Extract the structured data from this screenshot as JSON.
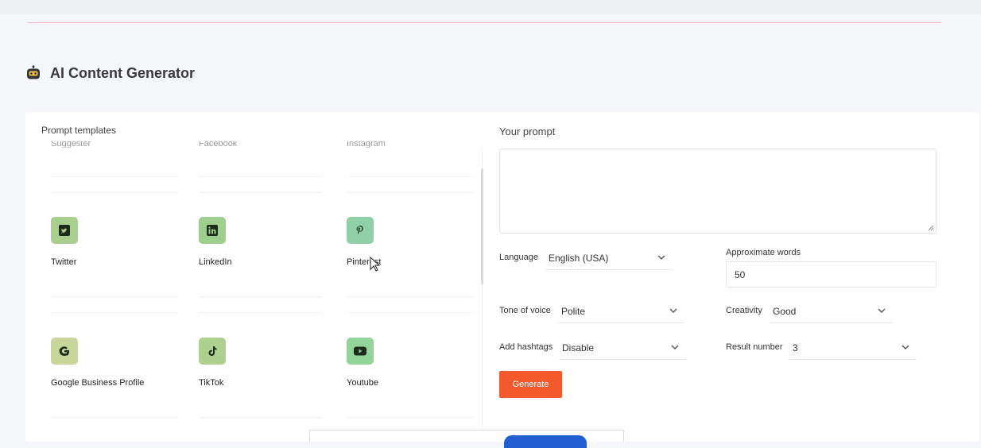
{
  "header": {
    "title": "AI Content Generator",
    "icon": "robot-icon"
  },
  "templates": {
    "label": "Prompt templates",
    "cut_row": [
      "Suggester",
      "Facebook",
      "Instagram"
    ],
    "items": [
      {
        "label": "Twitter",
        "icon": "twitter-icon",
        "color": "#a9cf8e"
      },
      {
        "label": "LinkedIn",
        "icon": "linkedin-icon",
        "color": "#9fcf8e"
      },
      {
        "label": "Pinterest",
        "icon": "pinterest-icon",
        "color": "#8fd0a8"
      },
      {
        "label": "Google Business Profile",
        "icon": "google-icon",
        "color": "#c9d69a"
      },
      {
        "label": "TikTok",
        "icon": "tiktok-icon",
        "color": "#aed08e"
      },
      {
        "label": "Youtube",
        "icon": "youtube-icon",
        "color": "#93d49a"
      }
    ]
  },
  "prompt": {
    "label": "Your prompt",
    "value": "",
    "language_label": "Language",
    "language_value": "English (USA)",
    "words_label": "Approximate words",
    "words_value": "50",
    "tone_label": "Tone of voice",
    "tone_value": "Polite",
    "creativity_label": "Creativity",
    "creativity_value": "Good",
    "hashtags_label": "Add hashtags",
    "hashtags_value": "Disable",
    "result_label": "Result number",
    "result_value": "3",
    "generate_label": "Generate"
  },
  "colors": {
    "accent": "#f4592c",
    "divider": "#f4b9c3",
    "bottom_button": "#1f5fcf"
  }
}
